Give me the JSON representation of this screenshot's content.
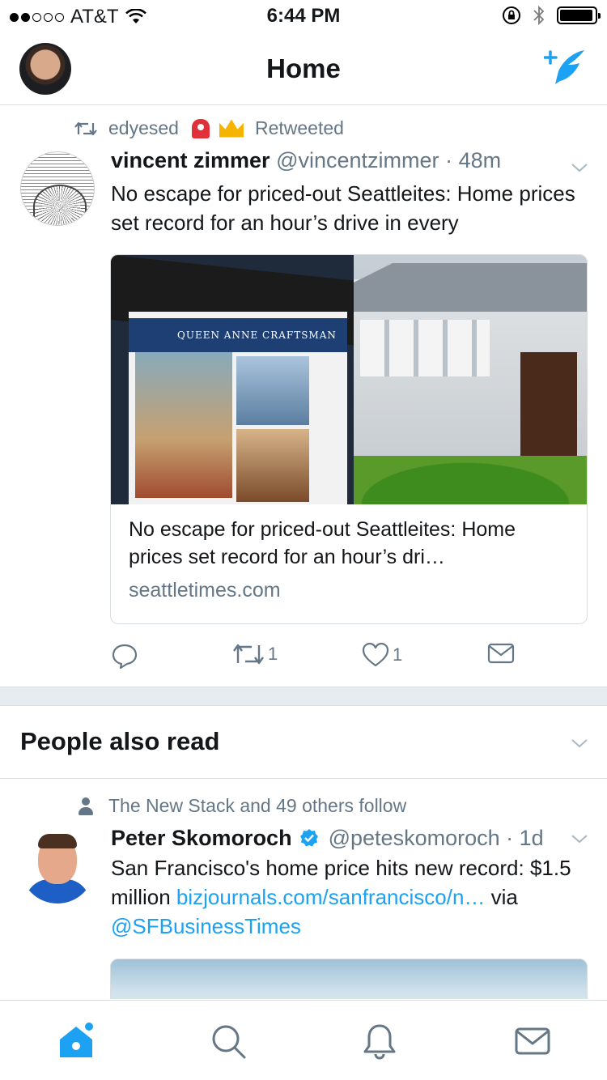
{
  "status_bar": {
    "carrier": "AT&T",
    "time": "6:44 PM",
    "signal_bars": 2,
    "signal_total": 5,
    "battery_level": 0.95
  },
  "nav": {
    "title": "Home"
  },
  "tweet1": {
    "retweeted_by": "edyesed",
    "retweeted_label": "Retweeted",
    "name": "vincent zimmer",
    "handle": "@vincentzimmer",
    "separator": "·",
    "time": "48m",
    "text": "No escape for priced-out Seattleites: Home prices set record for an hour’s drive in every",
    "card": {
      "sign_text": "QUEEN ANNE CRAFTSMAN",
      "title": "No escape for priced-out Seattleites: Home prices set record for an hour’s dri…",
      "domain": "seattletimes.com"
    },
    "actions": {
      "retweets": "1",
      "likes": "1"
    }
  },
  "section": {
    "title": "People also read"
  },
  "tweet2": {
    "context": "The New Stack and 49 others follow",
    "name": "Peter Skomoroch",
    "handle": "@peteskomoroch",
    "separator": "·",
    "time": "1d",
    "text_plain": "San Francisco's home price hits new record: $1.5 million",
    "link": "bizjournals.com/sanfrancisco/n…",
    "via": "via",
    "mention": "@SFBusinessTimes"
  },
  "colors": {
    "accent": "#1da1f2",
    "secondary_text": "#657786",
    "divider": "#e6ecf0"
  }
}
